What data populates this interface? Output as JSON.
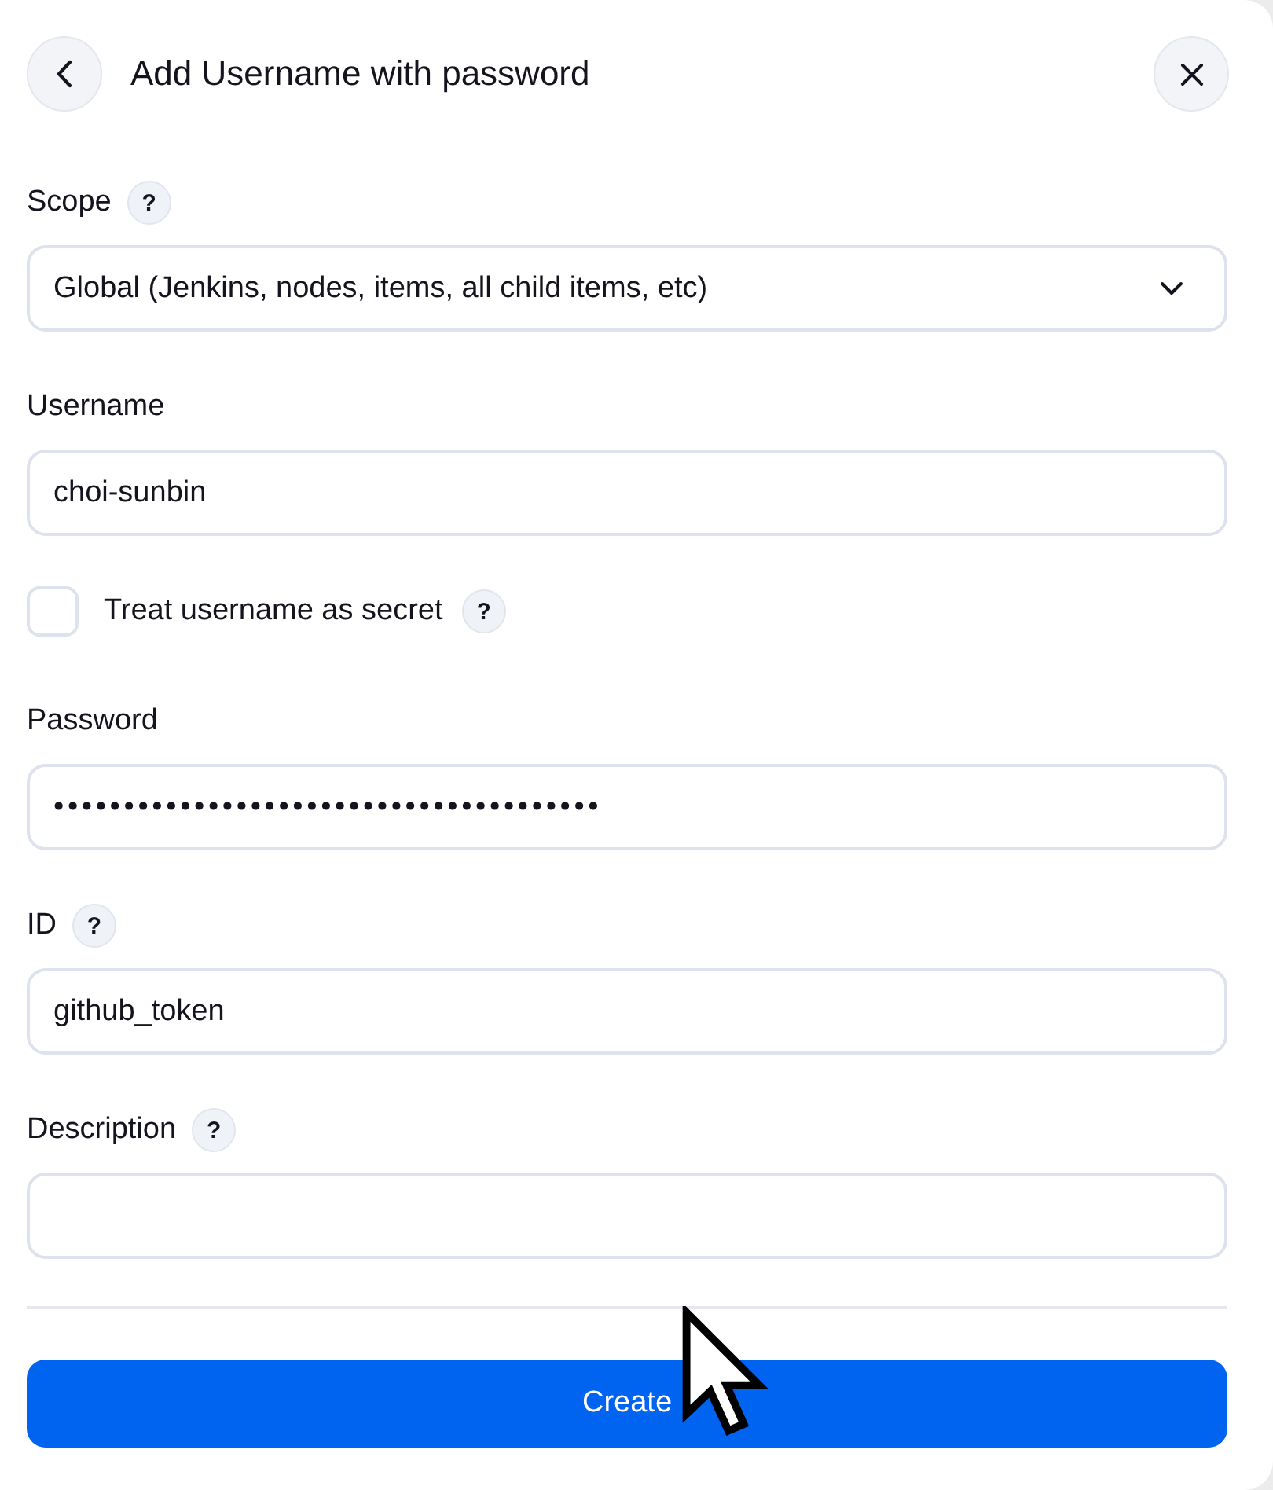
{
  "header": {
    "title": "Add Username with password"
  },
  "fields": [
    {
      "kind": "select",
      "label": "Scope",
      "help": "?",
      "value": "Global (Jenkins, nodes, items, all child items, etc)"
    },
    {
      "kind": "text",
      "label": "Username",
      "value": "choi-sunbin"
    },
    {
      "kind": "checkbox",
      "label": "Treat username as secret",
      "help": "?",
      "checked": false
    },
    {
      "kind": "password",
      "label": "Password",
      "value": "•••••••••••••••••••••••••••••••••••••••"
    },
    {
      "kind": "text",
      "label": "ID",
      "help": "?",
      "value": "github_token"
    },
    {
      "kind": "text",
      "label": "Description",
      "help": "?"
    }
  ],
  "submit": {
    "label": "Create"
  }
}
